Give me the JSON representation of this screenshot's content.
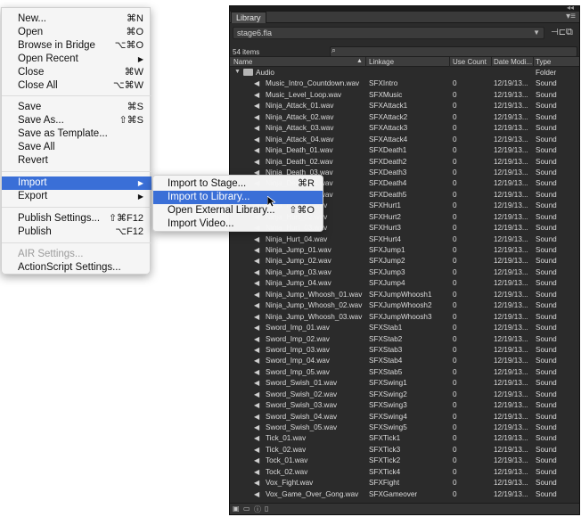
{
  "file_menu": {
    "items": [
      {
        "label": "New...",
        "shortcut": "⌘N"
      },
      {
        "label": "Open",
        "shortcut": "⌘O"
      },
      {
        "label": "Browse in Bridge",
        "shortcut": "⌥⌘O"
      },
      {
        "label": "Open Recent",
        "shortcut": "▶"
      },
      {
        "label": "Close",
        "shortcut": "⌘W"
      },
      {
        "label": "Close All",
        "shortcut": "⌥⌘W"
      },
      {
        "label": "Save",
        "shortcut": "⌘S"
      },
      {
        "label": "Save As...",
        "shortcut": "⇧⌘S"
      },
      {
        "label": "Save as Template...",
        "shortcut": ""
      },
      {
        "label": "Save All",
        "shortcut": ""
      },
      {
        "label": "Revert",
        "shortcut": ""
      },
      {
        "label": "Import",
        "shortcut": "▶"
      },
      {
        "label": "Export",
        "shortcut": "▶"
      },
      {
        "label": "Publish Settings...",
        "shortcut": "⇧⌘F12"
      },
      {
        "label": "Publish",
        "shortcut": "⌥F12"
      },
      {
        "label": "AIR Settings...",
        "shortcut": ""
      },
      {
        "label": "ActionScript Settings...",
        "shortcut": ""
      }
    ]
  },
  "import_submenu": {
    "items": [
      {
        "label": "Import to Stage...",
        "shortcut": "⌘R"
      },
      {
        "label": "Import to Library...",
        "shortcut": ""
      },
      {
        "label": "Open External Library...",
        "shortcut": "⇧⌘O"
      },
      {
        "label": "Import Video...",
        "shortcut": ""
      }
    ]
  },
  "library": {
    "tab": "Library",
    "document": "stage6.fla",
    "item_count": "54 items",
    "columns": [
      "Name",
      "Linkage",
      "Use Count",
      "Date Modi...",
      "Type"
    ],
    "folder": {
      "name": "Audio",
      "type": "Folder"
    },
    "rows": [
      {
        "name": "Music_Intro_Countdown.wav",
        "linkage": "SFXIntro",
        "use": "0",
        "date": "12/19/13...",
        "type": "Sound"
      },
      {
        "name": "Music_Level_Loop.wav",
        "linkage": "SFXMusic",
        "use": "0",
        "date": "12/19/13...",
        "type": "Sound"
      },
      {
        "name": "Ninja_Attack_01.wav",
        "linkage": "SFXAttack1",
        "use": "0",
        "date": "12/19/13...",
        "type": "Sound"
      },
      {
        "name": "Ninja_Attack_02.wav",
        "linkage": "SFXAttack2",
        "use": "0",
        "date": "12/19/13...",
        "type": "Sound"
      },
      {
        "name": "Ninja_Attack_03.wav",
        "linkage": "SFXAttack3",
        "use": "0",
        "date": "12/19/13...",
        "type": "Sound"
      },
      {
        "name": "Ninja_Attack_04.wav",
        "linkage": "SFXAttack4",
        "use": "0",
        "date": "12/19/13...",
        "type": "Sound"
      },
      {
        "name": "Ninja_Death_01.wav",
        "linkage": "SFXDeath1",
        "use": "0",
        "date": "12/19/13...",
        "type": "Sound"
      },
      {
        "name": "Ninja_Death_02.wav",
        "linkage": "SFXDeath2",
        "use": "0",
        "date": "12/19/13...",
        "type": "Sound"
      },
      {
        "name": "Ninja_Death_03.wav",
        "linkage": "SFXDeath3",
        "use": "0",
        "date": "12/19/13...",
        "type": "Sound"
      },
      {
        "name": "Ninja_Death_04.wav",
        "linkage": "SFXDeath4",
        "use": "0",
        "date": "12/19/13...",
        "type": "Sound"
      },
      {
        "name": "Ninja_Death_05.wav",
        "linkage": "SFXDeath5",
        "use": "0",
        "date": "12/19/13...",
        "type": "Sound"
      },
      {
        "name": "Ninja_Hurt_01.wav",
        "linkage": "SFXHurt1",
        "use": "0",
        "date": "12/19/13...",
        "type": "Sound"
      },
      {
        "name": "Ninja_Hurt_02.wav",
        "linkage": "SFXHurt2",
        "use": "0",
        "date": "12/19/13...",
        "type": "Sound"
      },
      {
        "name": "Ninja_Hurt_03.wav",
        "linkage": "SFXHurt3",
        "use": "0",
        "date": "12/19/13...",
        "type": "Sound"
      },
      {
        "name": "Ninja_Hurt_04.wav",
        "linkage": "SFXHurt4",
        "use": "0",
        "date": "12/19/13...",
        "type": "Sound"
      },
      {
        "name": "Ninja_Jump_01.wav",
        "linkage": "SFXJump1",
        "use": "0",
        "date": "12/19/13...",
        "type": "Sound"
      },
      {
        "name": "Ninja_Jump_02.wav",
        "linkage": "SFXJump2",
        "use": "0",
        "date": "12/19/13...",
        "type": "Sound"
      },
      {
        "name": "Ninja_Jump_03.wav",
        "linkage": "SFXJump3",
        "use": "0",
        "date": "12/19/13...",
        "type": "Sound"
      },
      {
        "name": "Ninja_Jump_04.wav",
        "linkage": "SFXJump4",
        "use": "0",
        "date": "12/19/13...",
        "type": "Sound"
      },
      {
        "name": "Ninja_Jump_Whoosh_01.wav",
        "linkage": "SFXJumpWhoosh1",
        "use": "0",
        "date": "12/19/13...",
        "type": "Sound"
      },
      {
        "name": "Ninja_Jump_Whoosh_02.wav",
        "linkage": "SFXJumpWhoosh2",
        "use": "0",
        "date": "12/19/13...",
        "type": "Sound"
      },
      {
        "name": "Ninja_Jump_Whoosh_03.wav",
        "linkage": "SFXJumpWhoosh3",
        "use": "0",
        "date": "12/19/13...",
        "type": "Sound"
      },
      {
        "name": "Sword_Imp_01.wav",
        "linkage": "SFXStab1",
        "use": "0",
        "date": "12/19/13...",
        "type": "Sound"
      },
      {
        "name": "Sword_Imp_02.wav",
        "linkage": "SFXStab2",
        "use": "0",
        "date": "12/19/13...",
        "type": "Sound"
      },
      {
        "name": "Sword_Imp_03.wav",
        "linkage": "SFXStab3",
        "use": "0",
        "date": "12/19/13...",
        "type": "Sound"
      },
      {
        "name": "Sword_Imp_04.wav",
        "linkage": "SFXStab4",
        "use": "0",
        "date": "12/19/13...",
        "type": "Sound"
      },
      {
        "name": "Sword_Imp_05.wav",
        "linkage": "SFXStab5",
        "use": "0",
        "date": "12/19/13...",
        "type": "Sound"
      },
      {
        "name": "Sword_Swish_01.wav",
        "linkage": "SFXSwing1",
        "use": "0",
        "date": "12/19/13...",
        "type": "Sound"
      },
      {
        "name": "Sword_Swish_02.wav",
        "linkage": "SFXSwing2",
        "use": "0",
        "date": "12/19/13...",
        "type": "Sound"
      },
      {
        "name": "Sword_Swish_03.wav",
        "linkage": "SFXSwing3",
        "use": "0",
        "date": "12/19/13...",
        "type": "Sound"
      },
      {
        "name": "Sword_Swish_04.wav",
        "linkage": "SFXSwing4",
        "use": "0",
        "date": "12/19/13...",
        "type": "Sound"
      },
      {
        "name": "Sword_Swish_05.wav",
        "linkage": "SFXSwing5",
        "use": "0",
        "date": "12/19/13...",
        "type": "Sound"
      },
      {
        "name": "Tick_01.wav",
        "linkage": "SFXTick1",
        "use": "0",
        "date": "12/19/13...",
        "type": "Sound"
      },
      {
        "name": "Tick_02.wav",
        "linkage": "SFXTick3",
        "use": "0",
        "date": "12/19/13...",
        "type": "Sound"
      },
      {
        "name": "Tock_01.wav",
        "linkage": "SFXTick2",
        "use": "0",
        "date": "12/19/13...",
        "type": "Sound"
      },
      {
        "name": "Tock_02.wav",
        "linkage": "SFXTick4",
        "use": "0",
        "date": "12/19/13...",
        "type": "Sound"
      },
      {
        "name": "Vox_Fight.wav",
        "linkage": "SFXFight",
        "use": "0",
        "date": "12/19/13...",
        "type": "Sound"
      },
      {
        "name": "Vox_Game_Over_Gong.wav",
        "linkage": "SFXGameover",
        "use": "0",
        "date": "12/19/13...",
        "type": "Sound"
      }
    ]
  },
  "colors": {
    "menu_highlight": "#3a6fd7",
    "panel_bg": "#2b2b2b"
  }
}
